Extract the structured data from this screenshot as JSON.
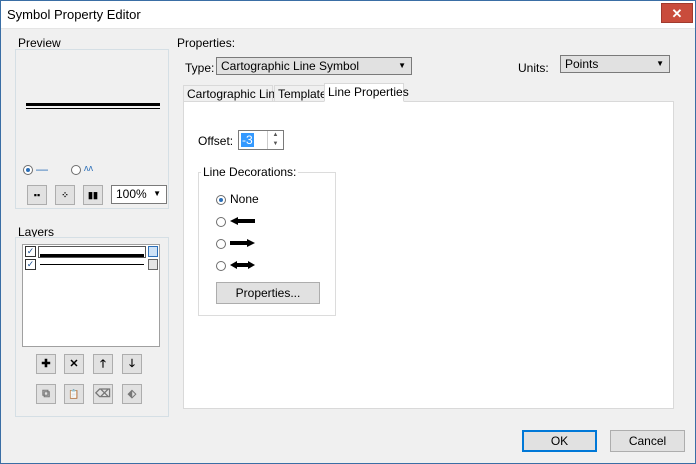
{
  "window": {
    "title": "Symbol Property Editor",
    "close_glyph": "✕"
  },
  "preview": {
    "label": "Preview",
    "mode_line_glyph": "—",
    "mode_zigzag_glyph": "ʌʌ",
    "zoom_value": "100%",
    "buttons": [
      "zoom-fit-icon",
      "zoom-extent-icon",
      "zoom-actual-icon"
    ]
  },
  "layers": {
    "label": "Layers",
    "items": [
      {
        "checked": "✓",
        "style": "thick-line"
      },
      {
        "checked": "✓",
        "style": "thin-line"
      }
    ],
    "buttons": {
      "add": "✚",
      "remove": "✕",
      "up": "🡑",
      "down": "🡓",
      "copy": "⧉",
      "paste": "📋",
      "delete2": "⌫",
      "edit": "⬖"
    }
  },
  "properties": {
    "label": "Properties:",
    "type_label": "Type:",
    "type_value": "Cartographic Line Symbol",
    "units_label": "Units:",
    "units_value": "Points"
  },
  "tabs": [
    {
      "label": "Cartographic Line",
      "active": false
    },
    {
      "label": "Template",
      "active": false
    },
    {
      "label": "Line Properties",
      "active": true
    }
  ],
  "line_properties": {
    "offset_label": "Offset:",
    "offset_value": "-3",
    "decorations_label": "Line Decorations:",
    "options": [
      {
        "label": "None",
        "selected": true
      },
      {
        "label": "",
        "selected": false,
        "icon": "arrow-start-decoration"
      },
      {
        "label": "",
        "selected": false,
        "icon": "arrow-end-decoration"
      },
      {
        "label": "",
        "selected": false,
        "icon": "arrow-both-decoration"
      }
    ],
    "properties_button": "Properties..."
  },
  "footer": {
    "ok": "OK",
    "cancel": "Cancel"
  }
}
